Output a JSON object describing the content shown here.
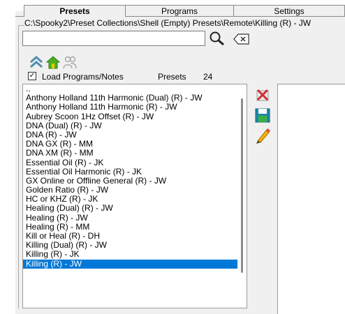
{
  "tabs": [
    {
      "label": "Presets",
      "active": true
    },
    {
      "label": "Programs",
      "active": false
    },
    {
      "label": "Settings",
      "active": false
    }
  ],
  "path_text": "C:\\Spooky2\\Preset Collections\\Shell (Empty) Presets\\Remote\\Killing (R) - JW",
  "search": {
    "value": "",
    "placeholder": ""
  },
  "toolbar": {
    "search_icon": "magnifier-icon",
    "clear_icon": "clear-text-icon",
    "up_icon": "double-up-arrow-icon",
    "home_icon": "home-icon",
    "user_icon": "users-icon"
  },
  "load_programs": {
    "label": "Load Programs/Notes",
    "checked": true
  },
  "presets_label": "Presets",
  "presets_count": "24",
  "list": {
    "items": [
      "..",
      "Anthony Holland 11th Harmonic (Dual) (R) - JW",
      "Anthony Holland 11th Harmonic (R) - JW",
      "Aubrey Scoon 1Hz Offset (R) - JW",
      "DNA (Dual) (R) - JW",
      "DNA (R) - JW",
      "DNA GX (R) - MM",
      "DNA XM (R) - MM",
      "Essential Oil (R) - JK",
      "Essential Oil Harmonic (R) - JK",
      "GX Online or Offline General (R) - JW",
      "Golden Ratio (R) - JW",
      "HC or KHZ (R) - JK",
      "Healing (Dual) (R) - JW",
      "Healing (R) - JW",
      "Healing (R) - MM",
      "Kill or Heal (R) - DH",
      "Killing (Dual) (R) - JW",
      "Killing (R) - JK",
      "Killing (R) - JW"
    ],
    "selected_index": 19
  },
  "side_buttons": [
    "delete-preset-icon",
    "save-preset-icon",
    "edit-preset-icon"
  ],
  "colors": {
    "selection": "#0078d7",
    "home_green": "#4caf1e",
    "panel_bg": "#f0f0f0"
  }
}
